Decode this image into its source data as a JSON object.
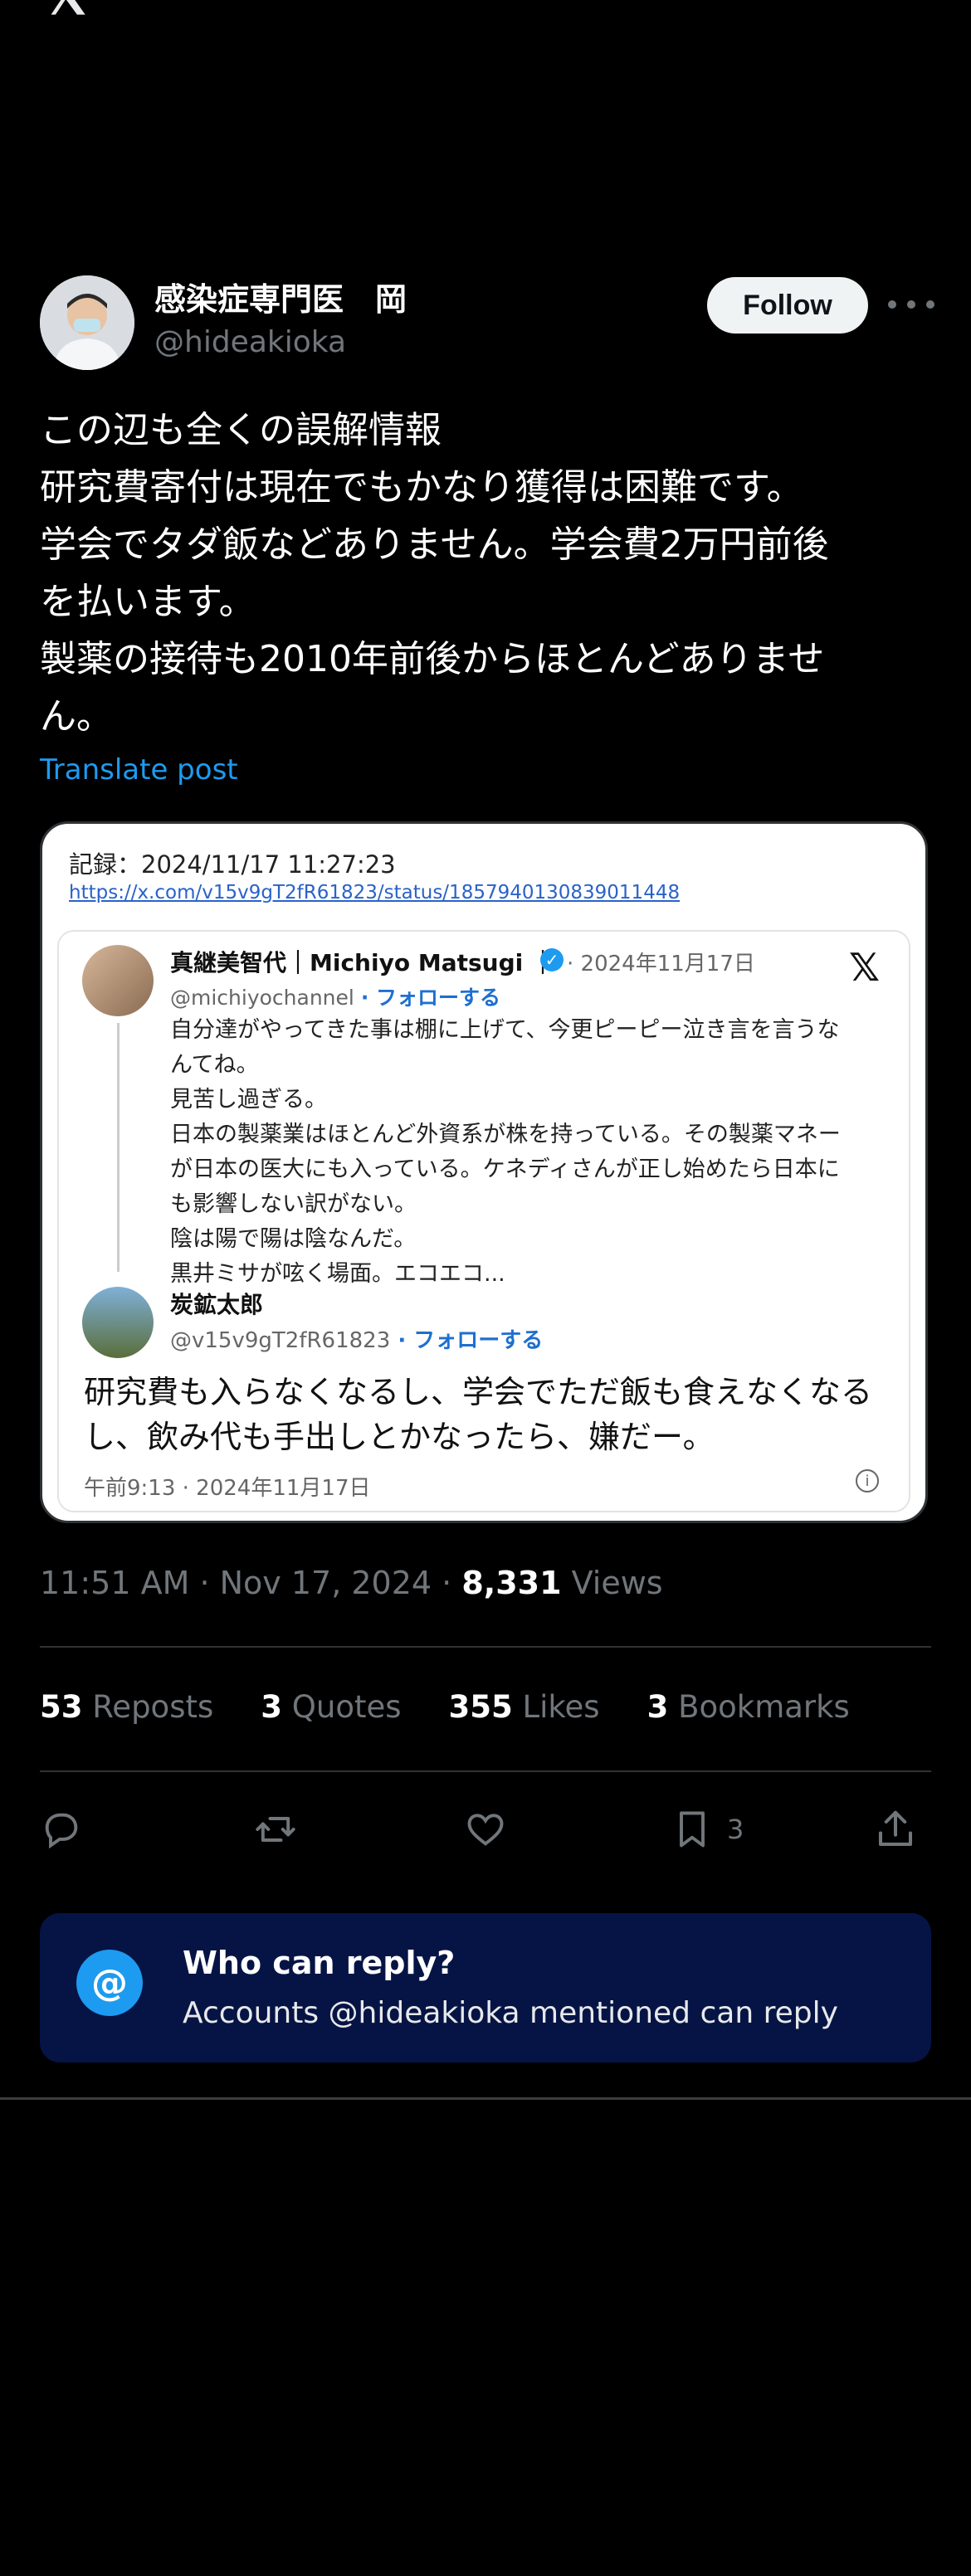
{
  "header": {
    "logo_icon": "x-logo-icon"
  },
  "author": {
    "name": "感染症専門医　岡",
    "handle": "@hideakioka",
    "follow_label": "Follow"
  },
  "post": {
    "lines": [
      "この辺も全くの誤解情報",
      "研究費寄付は現在でもかなり獲得は困難です。",
      "学会でタダ飯などありません。学会費2万円前後",
      "を払います。",
      "製薬の接待も2010年前後からほとんどありませ",
      "ん。"
    ],
    "translate_label": "Translate post"
  },
  "media": {
    "record": "記録：2024/11/17 11:27:23",
    "record_link": "https://x.com/v15v9gT2fR61823/status/1857940130839011448",
    "quote1": {
      "name": "真継美智代｜Michiyo Matsugi ｜",
      "date": "· 2024年11月17日",
      "handle": "@michiyochannel",
      "follow": "· フォローする",
      "lines": [
        "自分達がやってきた事は棚に上げて、今更ピーピー泣き言を言うな",
        "んてね。",
        "見苦し過ぎる。",
        "日本の製薬業はほとんど外資系が株を持っている。その製薬マネー",
        "が日本の医大にも入っている。ケネディさんが正し始めたら日本に",
        "も影響しない訳がない。",
        "陰は陽で陽は陰なんだ。",
        "黒井ミサが呟く場面。エコエコ..."
      ]
    },
    "quote2": {
      "name": "炭鉱太郎",
      "handle": "@v15v9gT2fR61823",
      "follow": " · フォローする",
      "lines": [
        "研究費も入らなくなるし、学会でただ飯も食えなくなる",
        "し、飲み代も手出しとかなったら、嫌だー。"
      ],
      "time": "午前9:13 · 2024年11月17日"
    }
  },
  "meta": {
    "time": "11:51 AM · Nov 17, 2024 · ",
    "views_count": "8,331",
    "views_label": " Views"
  },
  "stats": [
    {
      "count": "53",
      "label": " Reposts"
    },
    {
      "count": "3",
      "label": " Quotes"
    },
    {
      "count": "355",
      "label": " Likes"
    },
    {
      "count": "3",
      "label": " Bookmarks"
    }
  ],
  "actions": {
    "bookmark_count": "3"
  },
  "reply_restriction": {
    "icon": "@",
    "title": "Who can reply?",
    "subtitle": "Accounts @hideakioka mentioned can reply"
  },
  "colors": {
    "accent": "#1d9bf0",
    "reply_box": "#061445"
  }
}
